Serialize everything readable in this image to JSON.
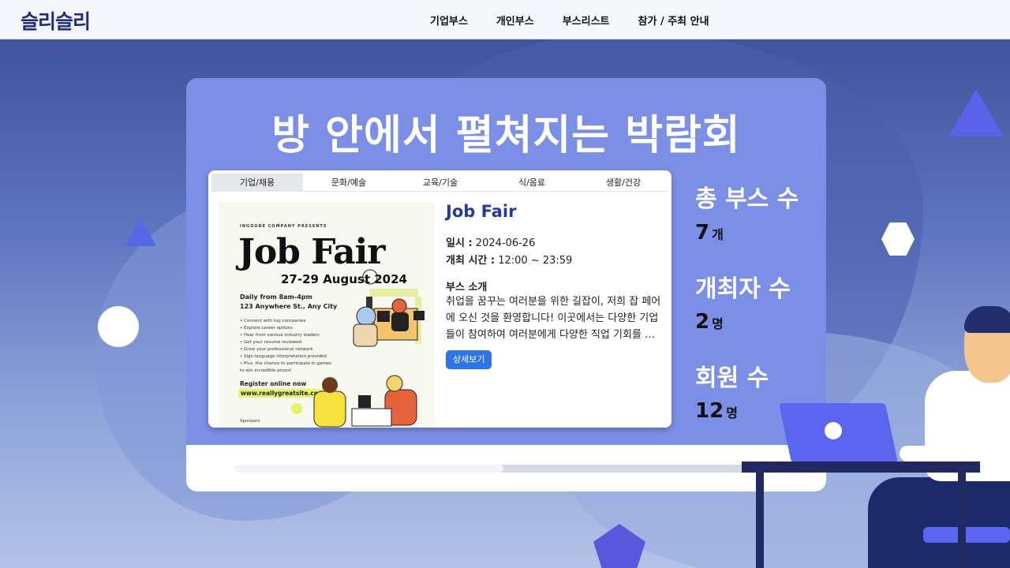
{
  "nav": {
    "logo": "슬리슬리",
    "items": [
      "기업부스",
      "개인부스",
      "부스리스트",
      "참가 / 주최 안내"
    ]
  },
  "hero": {
    "title": "방 안에서 펼쳐지는 박람회"
  },
  "card": {
    "tabs": [
      "기업/채용",
      "문화/예술",
      "교육/기술",
      "식/음료",
      "생활/건강"
    ],
    "active_tab": 0,
    "poster": {
      "presenter": "INGOUDE COMPANY PRESENTS",
      "title": "Job Fair",
      "date": "27-29 August 2024",
      "hours": "Daily from 8am-4pm",
      "address": "123 Anywhere St., Any City",
      "bullets": [
        "• Connect with top companies",
        "• Explore career options",
        "• Hear from various industry leaders",
        "• Get your resume reviewed",
        "• Grow your professional network",
        "• Sign language interpretation provided",
        "• Plus, the chance to participate in games",
        "   to win incredible prizes!"
      ],
      "register": "Register online now",
      "url": "www.reallygreatsite.com",
      "sponsors": "Sponsors"
    },
    "title": "Job Fair",
    "date_label": "일시 :",
    "date_value": "2024-06-26",
    "time_label": "개최 시간 :",
    "time_value": "12:00 ~ 23:59",
    "section_title": "부스 소개",
    "description": "취업을 꿈꾸는 여러분을 위한 길잡이, 저희 잡 페어에 오신 것을 환영합니다! 이곳에서는 다양한 기업들이 참여하여 여러분에게 다양한 직업 기회를 …",
    "button": "상세보기"
  },
  "stats": [
    {
      "label": "총 부스 수",
      "value": "7",
      "unit": "개"
    },
    {
      "label": "개최자 수",
      "value": "2",
      "unit": "명"
    },
    {
      "label": "회원 수",
      "value": "12",
      "unit": "명"
    }
  ],
  "colors": {
    "accent": "#2f73e8",
    "brand": "#1d2f7c",
    "monitor": "#7b8fe6"
  }
}
